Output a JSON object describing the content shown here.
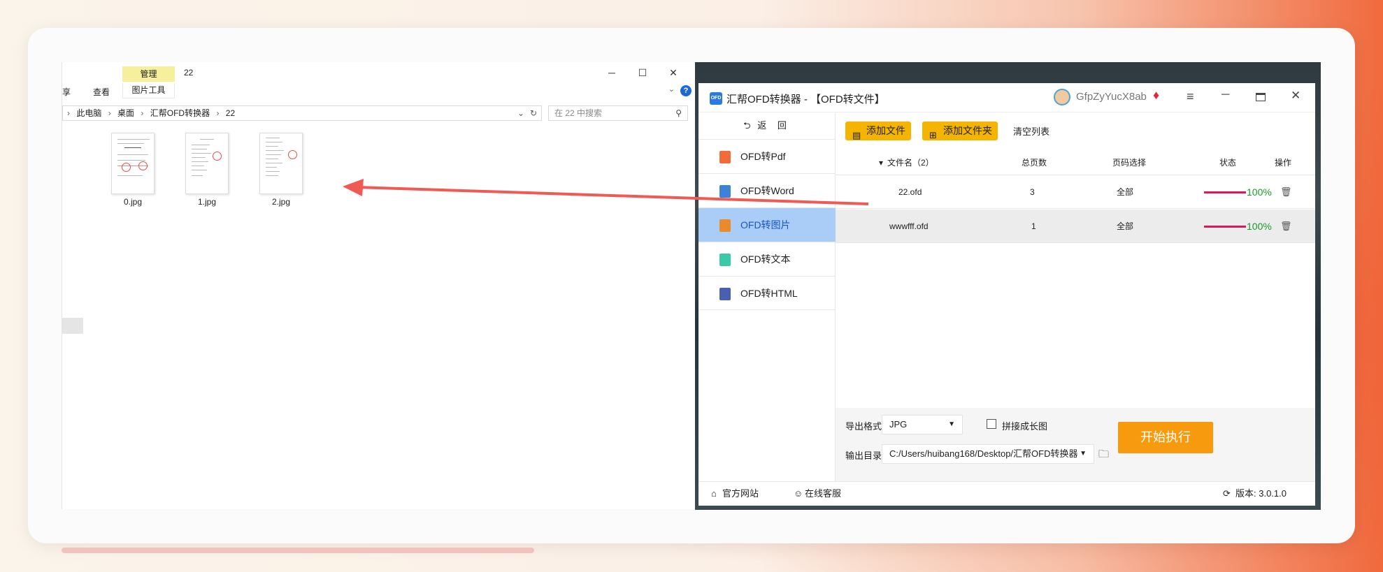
{
  "colors": {
    "accent_yellow": "#f4b400",
    "start_orange": "#f79a0d",
    "nav_active": "#a9cdf6",
    "progress_red": "#e3145e",
    "percent_green": "#1a9a2c",
    "arrow_red": "#f05a55"
  },
  "explorer": {
    "ribbon_context_label": "管理",
    "window_title": "22",
    "ribbon_tabs": [
      "共享",
      "查看"
    ],
    "ribbon_share_partial": "享",
    "ribbon_tools_label": "图片工具",
    "help_icon": "?",
    "address_parts": [
      "此电脑",
      "桌面",
      "汇帮OFD转换器",
      "22"
    ],
    "search_placeholder": "在 22 中搜索",
    "files": [
      {
        "name": "0.jpg",
        "icon": "document-thumbnail"
      },
      {
        "name": "1.jpg",
        "icon": "document-thumbnail"
      },
      {
        "name": "2.jpg",
        "icon": "document-thumbnail"
      }
    ]
  },
  "converter": {
    "logo_text": "OFD",
    "title": "汇帮OFD转换器 - 【OFD转文件】",
    "username": "GfpZyYucX8ab",
    "back_label": "返 回",
    "nav": [
      {
        "label": "OFD转Pdf",
        "icon": "pdf-icon",
        "color": "#f26b3a",
        "active": false
      },
      {
        "label": "OFD转Word",
        "icon": "word-icon",
        "color": "#3b82d8",
        "active": false
      },
      {
        "label": "OFD转图片",
        "icon": "image-icon",
        "color": "#e98a2c",
        "active": true
      },
      {
        "label": "OFD转文本",
        "icon": "text-icon",
        "color": "#3cc9a8",
        "active": false
      },
      {
        "label": "OFD转HTML",
        "icon": "html-icon",
        "color": "#4a5fb0",
        "active": false
      }
    ],
    "toolbar": {
      "add_file": "添加文件",
      "add_folder": "添加文件夹",
      "clear_list": "清空列表"
    },
    "table": {
      "headers": {
        "name": "文件名（2）",
        "pages": "总页数",
        "page_select": "页码选择",
        "status": "状态",
        "action": "操作"
      },
      "rows": [
        {
          "name": "22.ofd",
          "pages": "3",
          "page_select": "全部",
          "progress": 1.0,
          "status": "100%"
        },
        {
          "name": "wwwfff.ofd",
          "pages": "1",
          "page_select": "全部",
          "progress": 1.0,
          "status": "100%"
        }
      ]
    },
    "export": {
      "format_label": "导出格式:",
      "format_value": "JPG",
      "merge_label": "拼接成长图",
      "merge_checked": false,
      "dir_label": "输出目录:",
      "dir_value": "C:/Users/huibang168/Desktop/汇帮OFD转换器",
      "start_label": "开始执行"
    },
    "footer": {
      "website": "官方网站",
      "support": "在线客服",
      "version": "版本: 3.0.1.0"
    }
  }
}
